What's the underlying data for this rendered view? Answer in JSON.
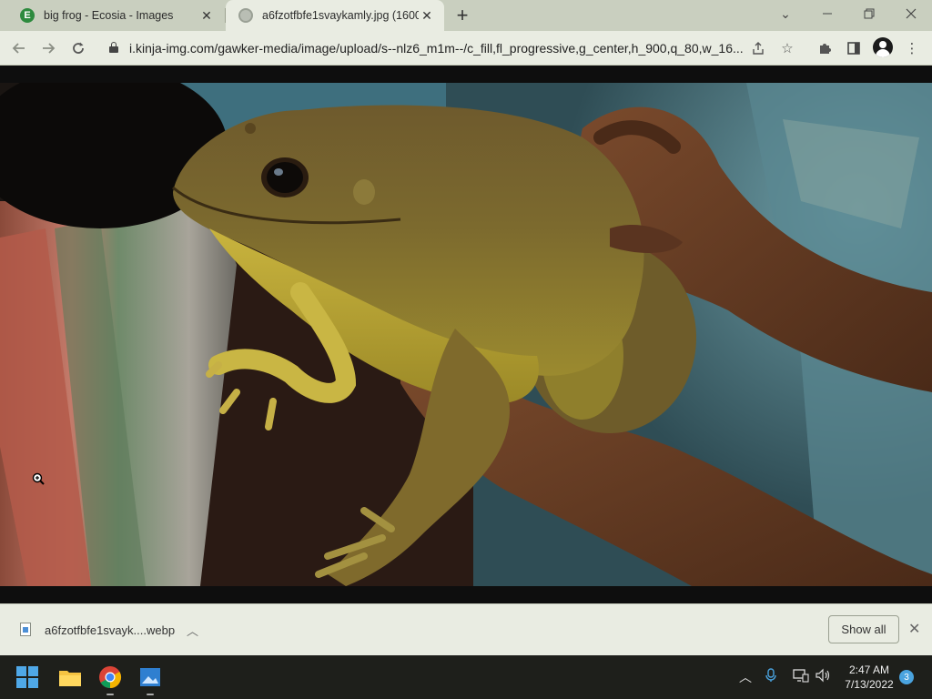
{
  "browser": {
    "tabs": [
      {
        "title": "big frog - Ecosia - Images",
        "favicon_letter": "E",
        "active": false
      },
      {
        "title": "a6fzotfbfe1svaykamly.jpg (1600×",
        "active": true
      }
    ],
    "new_tab_symbol": "+",
    "url": "i.kinja-img.com/gawker-media/image/upload/s--nlz6_m1m--/c_fill,fl_progressive,g_center,h_900,q_80,w_16..."
  },
  "download_bar": {
    "file_name": "a6fzotfbfe1svayk....webp",
    "show_all_label": "Show all"
  },
  "taskbar": {
    "time": "2:47 AM",
    "date": "7/13/2022",
    "notification_count": "3"
  },
  "colors": {
    "accent": "#4aa3df",
    "tabstrip": "#c9cfbf",
    "toolbar": "#e9ece2"
  }
}
